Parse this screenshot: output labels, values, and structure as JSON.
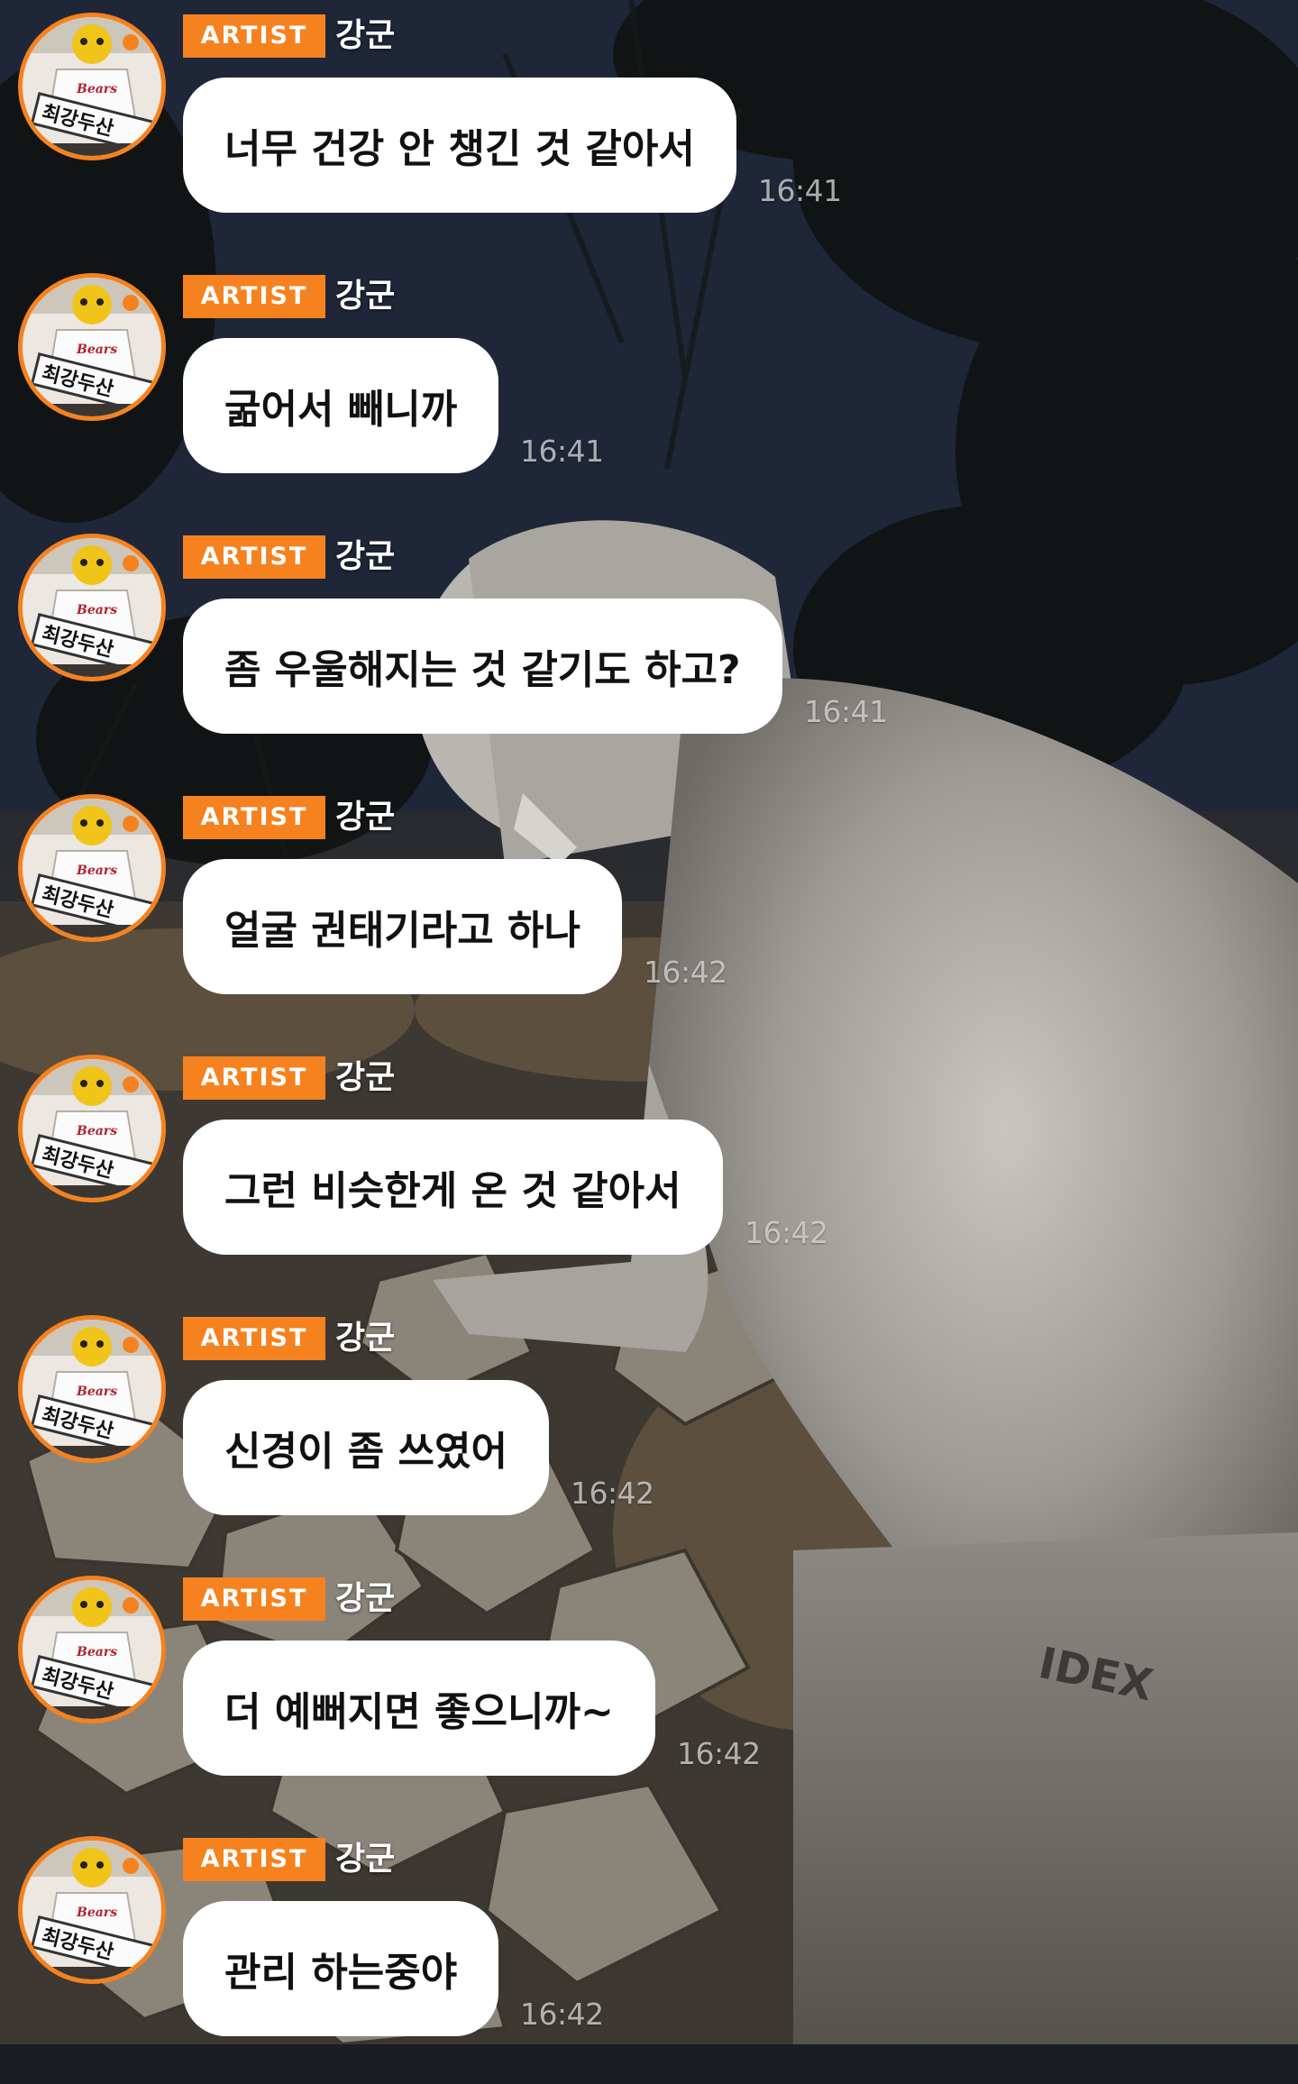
{
  "chat": {
    "badge_label": "ARTIST",
    "author": "강군",
    "messages": [
      {
        "text": "너무 건강 안 챙긴 것 같아서",
        "time": "16:41"
      },
      {
        "text": "굶어서 빼니까",
        "time": "16:41"
      },
      {
        "text": "좀 우울해지는 것 같기도 하고?",
        "time": "16:41"
      },
      {
        "text": "얼굴 권태기라고 하나",
        "time": "16:42"
      },
      {
        "text": "그런 비슷한게 온 것 같아서",
        "time": "16:42"
      },
      {
        "text": "신경이 좀 쓰였어",
        "time": "16:42"
      },
      {
        "text": "더 예뻐지면 좋으니까~",
        "time": "16:42"
      },
      {
        "text": "관리 하는중야",
        "time": "16:42"
      }
    ]
  },
  "colors": {
    "badge": "#f5821f",
    "bubble": "#ffffff",
    "avatar_ring": "#f5821f"
  },
  "avatar": {
    "sign_text": "최강두산",
    "jersey_text": "Bears"
  }
}
